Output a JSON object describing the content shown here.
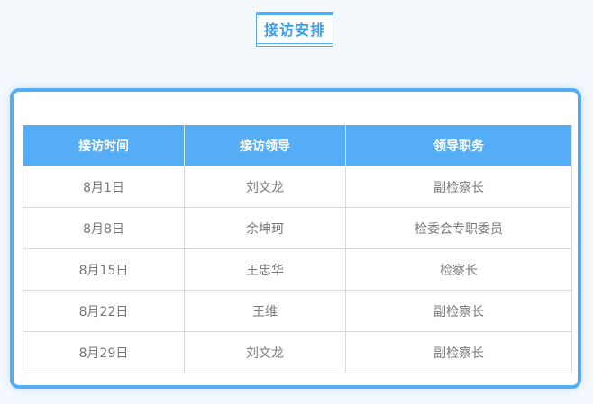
{
  "title": "接访安排",
  "table": {
    "headers": [
      "接访时间",
      "接访领导",
      "领导职务"
    ],
    "rows": [
      [
        "8月1日",
        "刘文龙",
        "副检察长"
      ],
      [
        "8月8日",
        "余坤珂",
        "检委会专职委员"
      ],
      [
        "8月15日",
        "王忠华",
        "检察长"
      ],
      [
        "8月22日",
        "王维",
        "副检察长"
      ],
      [
        "8月29日",
        "刘文龙",
        "副检察长"
      ]
    ]
  },
  "colors": {
    "accent": "#55aef5",
    "title_text": "#3a9ef0",
    "cell_text": "#777777",
    "page_background": "#f4f9fe"
  }
}
